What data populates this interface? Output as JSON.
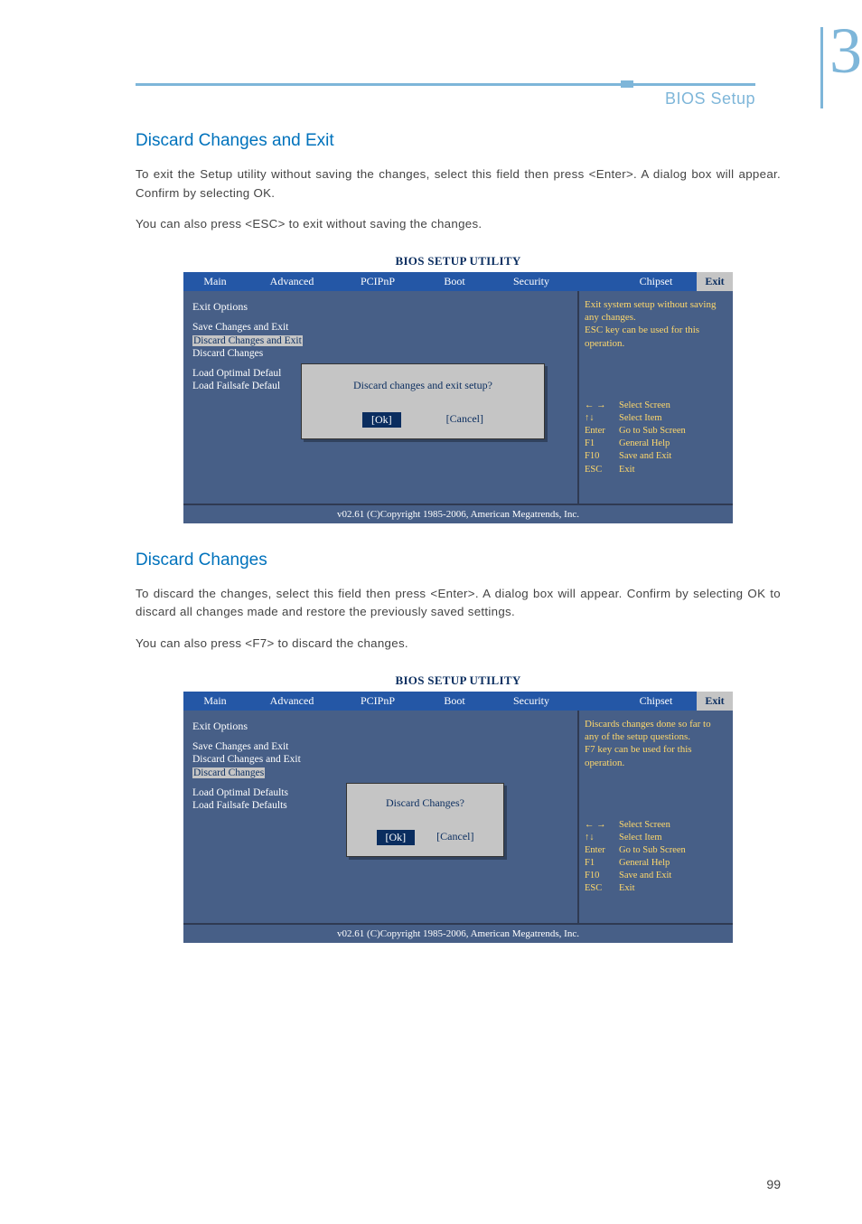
{
  "chapter": {
    "number": "3",
    "label": "BIOS Setup"
  },
  "page_number": "99",
  "sections": {
    "s1": {
      "heading": "Discard Changes and Exit",
      "p1": "To exit the Setup utility without saving the changes, select this field then press <Enter>. A dialog box will appear. Confirm by selecting OK.",
      "p2": "You can also press <ESC> to exit without saving the changes."
    },
    "s2": {
      "heading": "Discard Changes",
      "p1": "To discard the changes, select this field then press <Enter>. A dialog box will appear. Confirm by selecting OK to discard all changes made and restore the previously saved settings.",
      "p2": "You can also press <F7> to discard the changes."
    }
  },
  "bios_common": {
    "title": "BIOS SETUP UTILITY",
    "menus": {
      "m1": "Main",
      "m2": "Advanced",
      "m3": "PCIPnP",
      "m4": "Boot",
      "m5": "Security",
      "m6": "Chipset",
      "m7": "Exit"
    },
    "footer": "v02.61 (C)Copyright 1985-2006, American Megatrends, Inc.",
    "nav": {
      "r1k": "←  →",
      "r1v": "Select Screen",
      "r2k": "↑↓",
      "r2v": "Select Item",
      "r3k": "Enter",
      "r3v": "Go to Sub Screen",
      "r4k": "F1",
      "r4v": "General Help",
      "r5k": "F10",
      "r5v": "Save and Exit",
      "r6k": "ESC",
      "r6v": "Exit"
    },
    "exit_menu": {
      "header": "Exit Options",
      "i1": "Save Changes and Exit",
      "i2": "Discard Changes and Exit",
      "i3": "Discard Changes"
    }
  },
  "bios1": {
    "exit_menu": {
      "i4": "Load Optimal Defaul",
      "i5": "Load Failsafe Defaul"
    },
    "help": "Exit system setup without saving any changes.\nESC key can be used for this operation.",
    "dialog": {
      "title": "Discard changes and exit setup?",
      "ok": "[Ok]",
      "cancel": "[Cancel]"
    }
  },
  "bios2": {
    "exit_menu": {
      "i4": "Load Optimal Defaults",
      "i5": "Load Failsafe Defaults"
    },
    "help": "Discards changes done so far to any of the setup questions.\nF7 key can be used for this operation.",
    "dialog": {
      "title": "Discard Changes?",
      "ok": "[Ok]",
      "cancel": "[Cancel]"
    }
  }
}
